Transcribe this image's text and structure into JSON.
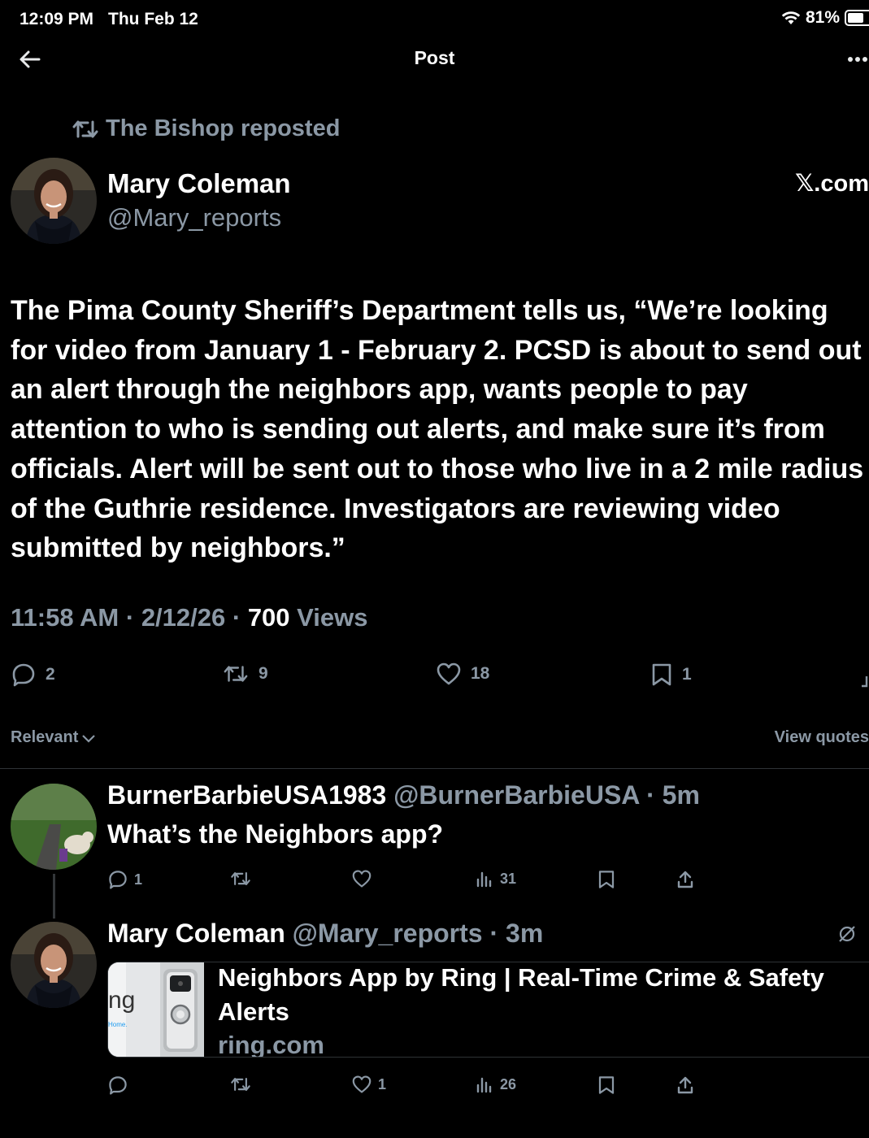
{
  "status_bar": {
    "time": "12:09 PM",
    "date": "Thu Feb 12",
    "battery": "81%",
    "battery_level": 0.81
  },
  "nav": {
    "title": "Post"
  },
  "repost": {
    "text": "The Bishop reposted"
  },
  "post": {
    "author_name": "Mary Coleman",
    "author_handle": "@Mary_reports",
    "source": "𝕏.com",
    "text": "The Pima County Sheriff’s Department tells us, “We’re looking for video from January 1 - February 2. PCSD is about to send out an alert through the neighbors app, wants people to pay attention to who is sending out alerts, and make sure it’s from officials. Alert will be sent out to those who live in a 2 mile radius of the Guthrie residence. Investigators are reviewing video submitted by neighbors.”",
    "time": "11:58 AM",
    "date": "2/12/26",
    "views_count": "700",
    "views_label": "Views",
    "stats": {
      "replies": "2",
      "reposts": "9",
      "likes": "18",
      "bookmarks": "1"
    }
  },
  "replies_bar": {
    "sort": "Relevant",
    "view_quotes": "View quotes"
  },
  "replies": [
    {
      "name": "BurnerBarbieUSA1983",
      "handle": "@BurnerBarbieUSA",
      "time": "5m",
      "text": "What’s the Neighbors app?",
      "stats": {
        "replies": "1",
        "reposts": "",
        "likes": "",
        "views": "31"
      }
    },
    {
      "name": "Mary Coleman",
      "handle": "@Mary_reports",
      "time": "3m",
      "link_card": {
        "title": "Neighbors App by Ring | Real-Time Crime & Safety Alerts",
        "domain": "ring.com",
        "thumb_text": "ng",
        "thumb_sub": "Home."
      },
      "stats": {
        "replies": "",
        "reposts": "",
        "likes": "1",
        "views": "26"
      }
    }
  ],
  "colors": {
    "background": "#000000",
    "text": "#e7e9ea",
    "secondary": "#8b98a5",
    "accent": "#1d9bf0",
    "divider": "#2f3336"
  },
  "icons": [
    "back-arrow-icon",
    "more-icon",
    "repost-icon",
    "reply-icon",
    "like-icon",
    "bookmark-icon",
    "views-icon",
    "share-icon",
    "wifi-icon",
    "battery-icon",
    "grok-icon",
    "chevron-down-icon"
  ]
}
